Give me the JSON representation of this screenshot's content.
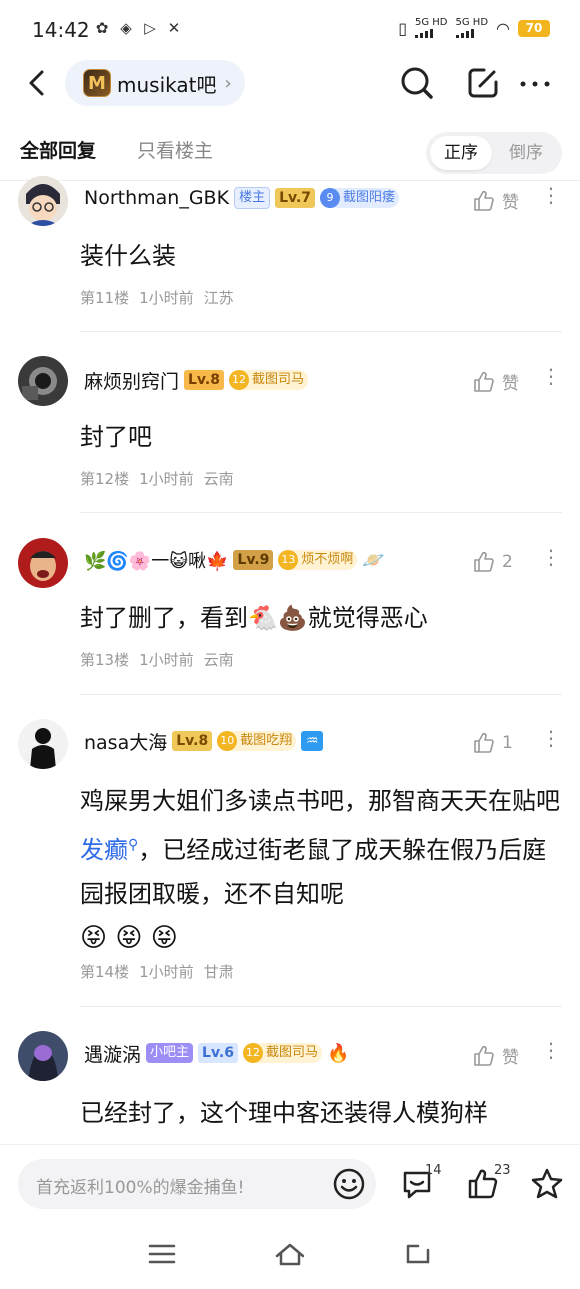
{
  "status": {
    "time": "14:42",
    "net1": "5G HD",
    "net2": "5G HD",
    "battery": "70"
  },
  "header": {
    "forum_name": "musikat吧",
    "forum_logo_letter": "M",
    "back_icon": "chevron-left-icon",
    "search_icon": "search-icon",
    "edit_icon": "edit-icon",
    "more_icon": "more-icon"
  },
  "tabs": {
    "all": "全部回复",
    "op_only": "只看楼主",
    "asc": "正序",
    "desc": "倒序"
  },
  "comments": [
    {
      "username": "Northman_GBK",
      "role_badge": "楼主",
      "level": "Lv.7",
      "title_num": "9",
      "title": "截图阳痿",
      "like_label": "赞",
      "text": "装什么装",
      "floor": "第11楼",
      "time": "1小时前",
      "location": "江苏"
    },
    {
      "username": "麻烦别窍门",
      "level": "Lv.8",
      "title_num": "12",
      "title": "截图司马",
      "like_label": "赞",
      "text": "封了吧",
      "floor": "第12楼",
      "time": "1小时前",
      "location": "云南"
    },
    {
      "username": "🌿🌀🌸一😺啾🍁",
      "level": "Lv.9",
      "title_num": "13",
      "title": "烦不烦啊",
      "like_label": "2",
      "text": "封了删了，看到🐔💩就觉得恶心",
      "floor": "第13楼",
      "time": "1小时前",
      "location": "云南"
    },
    {
      "username": "nasa大海",
      "level": "Lv.8",
      "title_num": "10",
      "title": "截图吃翔",
      "like_label": "1",
      "text_before": "鸡屎男大姐们多读点书吧，那智商天天在贴吧",
      "text_link": "发癫",
      "text_after": "，已经成过街老鼠了成天躲在假乃后庭园报团取暖，还不自知呢",
      "text_emojis": "😝 😝 😝",
      "floor": "第14楼",
      "time": "1小时前",
      "location": "甘肃"
    },
    {
      "username": "遇漩涡",
      "role_badge": "小吧主",
      "level": "Lv.6",
      "title_num": "12",
      "title": "截图司马",
      "like_label": "赞",
      "text": "已经封了，这个理中客还装得人模狗样"
    }
  ],
  "bottom": {
    "placeholder": "首充返利100%的爆金捕鱼!",
    "comment_count": "14",
    "like_count": "23"
  },
  "nav": {
    "menu_icon": "menu-icon",
    "home_icon": "home-icon",
    "back_icon": "back-icon"
  },
  "colors": {
    "link": "#2e6be6",
    "accent_gold": "#f4b523",
    "accent_blue": "#5a8bf0"
  }
}
